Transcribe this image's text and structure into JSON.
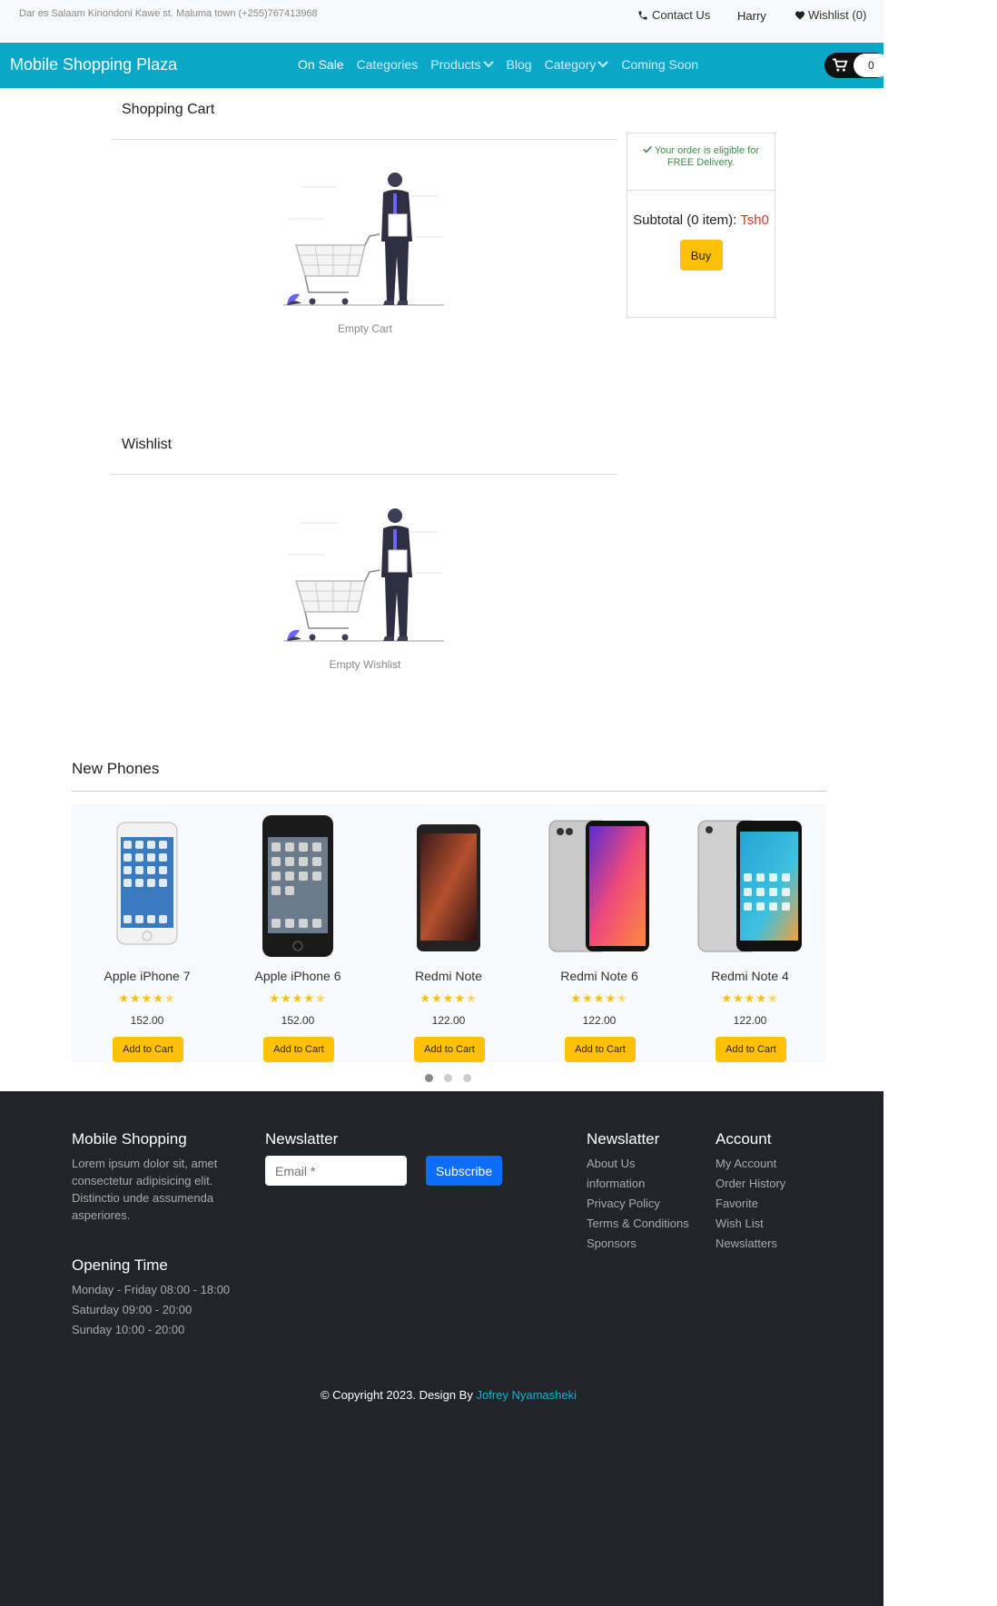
{
  "topbar": {
    "address": "Dar es Salaam Kinondoni Kawe st. Maluma town (+255)767413968",
    "contact": "Contact Us",
    "user": "Harry",
    "wishlist": "Wishlist (0)"
  },
  "navbar": {
    "brand": "Mobile Shopping Plaza",
    "links": [
      "On Sale",
      "Categories",
      "Products",
      "Blog",
      "Category",
      "Coming Soon"
    ],
    "cart_count": "0"
  },
  "cart": {
    "title": "Shopping Cart",
    "empty": "Empty Cart"
  },
  "summary": {
    "eligible": "Your order is eligible for FREE Delivery.",
    "subtotal_label": "Subtotal (0 item):",
    "subtotal_amount": "Tsh0",
    "buy": "Buy"
  },
  "wishlist": {
    "title": "Wishlist",
    "empty": "Empty Wishlist"
  },
  "new_phones": {
    "title": "New Phones",
    "add_label": "Add to Cart",
    "items": [
      {
        "name": "Apple iPhone 7",
        "price": "152.00",
        "rating": 4.5
      },
      {
        "name": "Apple iPhone 6",
        "price": "152.00",
        "rating": 4.5
      },
      {
        "name": "Redmi Note",
        "price": "122.00",
        "rating": 4.5
      },
      {
        "name": "Redmi Note 6",
        "price": "122.00",
        "rating": 4.5
      },
      {
        "name": "Redmi Note 4",
        "price": "122.00",
        "rating": 4.5
      }
    ],
    "slides": 3,
    "active_slide": 1
  },
  "footer": {
    "about_title": "Mobile Shopping",
    "about_text": "Lorem ipsum dolor sit, amet consectetur adipisicing elit. Distinctio unde assumenda asperiores.",
    "newsletter_title": "Newslatter",
    "email_placeholder": "Email *",
    "subscribe": "Subscribe",
    "opening_title": "Opening Time",
    "opening": [
      "Monday - Friday 08:00 - 18:00",
      "Saturday 09:00 - 20:00",
      "Sunday 10:00 - 20:00"
    ],
    "links_title": "Newslatter",
    "links": [
      "About Us",
      "information",
      "Privacy Policy",
      "Terms & Conditions",
      "Sponsors"
    ],
    "account_title": "Account",
    "account": [
      "My Account",
      "Order History",
      "Favorite",
      "Wish List",
      "Newslatters"
    ],
    "copyright": "© Copyright 2023. Design By",
    "author": "Jofrey Nyamasheki"
  },
  "colors": {
    "navbar": "#0aa8c8",
    "accent_yellow": "#ffc107",
    "footer": "#212529",
    "subscribe": "#0d6efd",
    "price_red": "#d9342b"
  }
}
